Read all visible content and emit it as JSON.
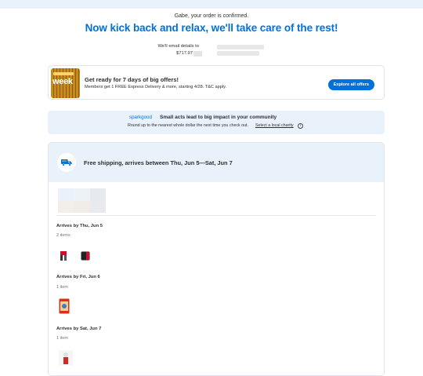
{
  "header": {
    "confirm_line": "Gabe, your order is confirmed.",
    "headline": "Now kick back and relax, we'll take care of the rest!",
    "email_label": "We'll email details to",
    "order_total": "$717.97"
  },
  "promo": {
    "art_word": "week",
    "title": "Get ready for 7 days of big offers!",
    "subtitle": "Members get 1 FREE Express Delivery & more, starting 4/28. T&C apply.",
    "button_label": "Explore all offers"
  },
  "spark": {
    "logo": "sparkgood",
    "title": "Small acts lead to big impact in your community",
    "subtitle": "Round up to the nearest whole dollar the next time you check out.",
    "link_label": "Select a local charity",
    "info_glyph": "i"
  },
  "shipment": {
    "title": "Free shipping, arrives between Thu, Jun 5—Sat, Jun 7",
    "groups": [
      {
        "title": "Arrives by Thu, Jun 5",
        "count": "2 items"
      },
      {
        "title": "Arrives by Fri, Jun 6",
        "count": "1 item"
      },
      {
        "title": "Arrives by Sat, Jun 7",
        "count": "1 item"
      }
    ]
  },
  "colors": {
    "brand_blue": "#0071dc",
    "light_blue_bg": "#e9f1fb",
    "text": "#2e2f32",
    "muted": "#74767c"
  },
  "icons": [
    "truck-icon",
    "info-icon"
  ]
}
